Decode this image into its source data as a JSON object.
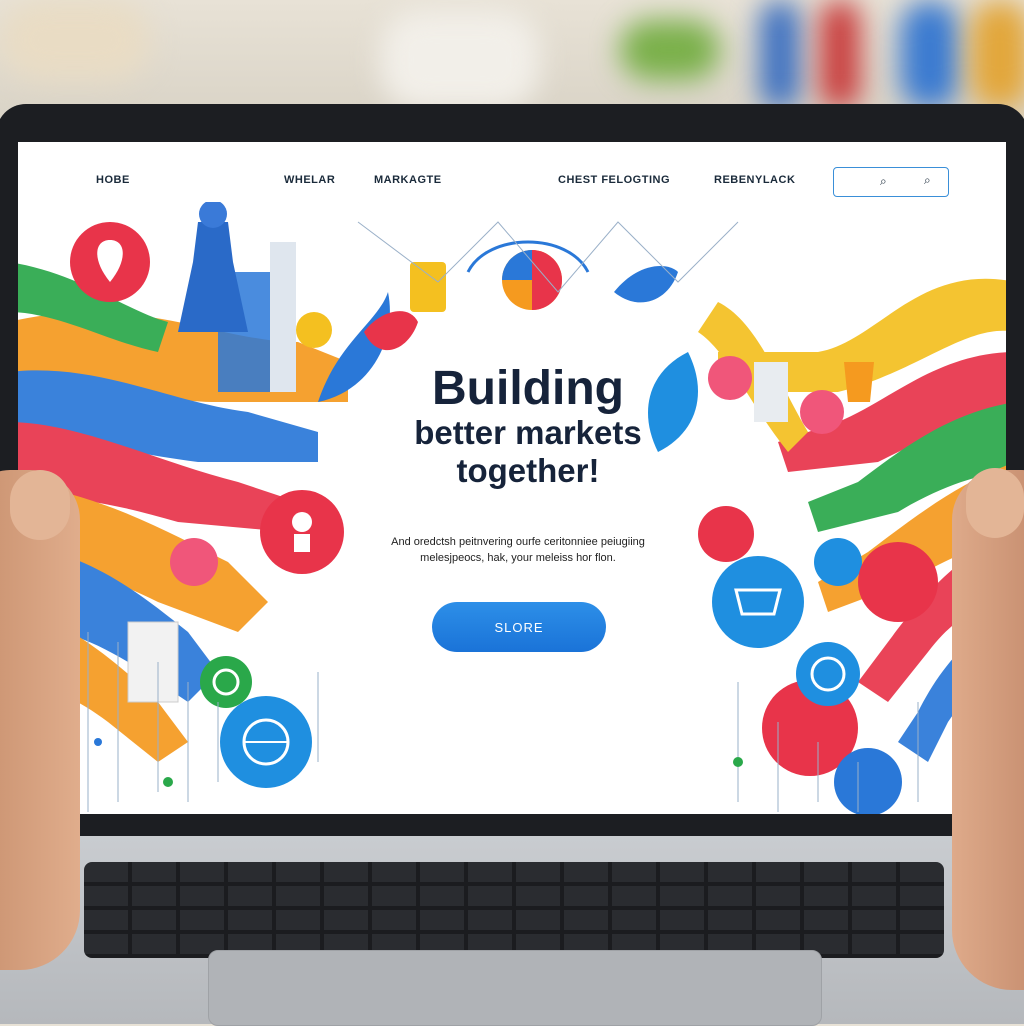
{
  "nav": {
    "items": [
      "HOBE",
      "WHELAR",
      "MARKAGTE",
      "CHEST FELOGTING",
      "REBENYLACK"
    ]
  },
  "search": {
    "icon": "search-icon",
    "icon2": "search-icon"
  },
  "hero": {
    "title_line1": "Building",
    "title_line2": "better markets",
    "title_line3": "together!",
    "subtitle_line1": "And oredctsh peitnvering ourfe ceritonniee peiugiing",
    "subtitle_line2": "melesjpeocs, hak, your meleiss hor flon.",
    "cta_label": "SLORE"
  },
  "colors": {
    "accent": "#1f7fe0",
    "red": "#e8344a",
    "orange": "#f59a1f",
    "yellow": "#f4c020",
    "green": "#2aa84a",
    "blue": "#2a78d8",
    "pink": "#f0567a"
  }
}
